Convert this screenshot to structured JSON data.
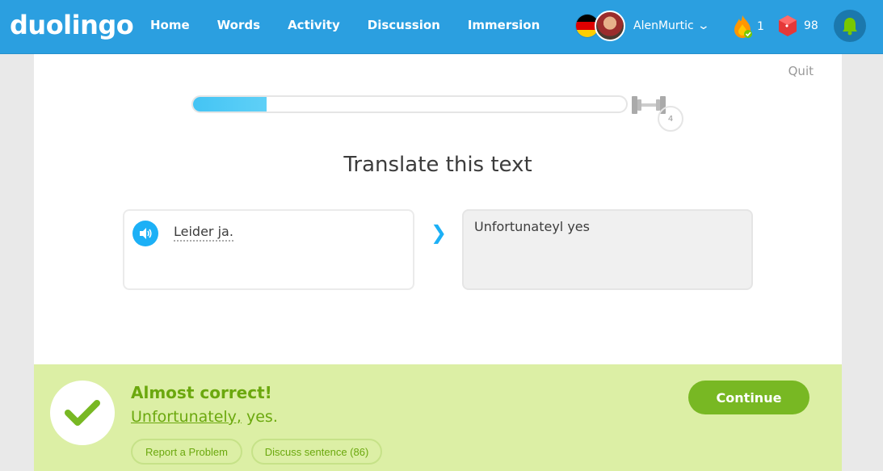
{
  "brand": {
    "logo": "duolingo"
  },
  "nav": {
    "items": [
      "Home",
      "Words",
      "Activity",
      "Discussion",
      "Immersion"
    ]
  },
  "user": {
    "name": "AlenMurtic",
    "streak": "1",
    "gems": "98"
  },
  "lesson": {
    "quit_label": "Quit",
    "progress_percent": 17,
    "level_badge": "4",
    "title": "Translate this text",
    "source_text": "Leider ja.",
    "answer_text": "Unfortunateyl yes"
  },
  "result": {
    "title": "Almost correct!",
    "correct_word": "Unfortunately,",
    "correct_rest": " yes.",
    "report_label": "Report a Problem",
    "discuss_label": "Discuss sentence (86)",
    "continue_label": "Continue"
  },
  "colors": {
    "topbar": "#2b9fe0",
    "progress": "#44c4f4",
    "result_bg": "#dcefa5",
    "result_text": "#6ba80e",
    "continue_bg": "#78b823"
  }
}
